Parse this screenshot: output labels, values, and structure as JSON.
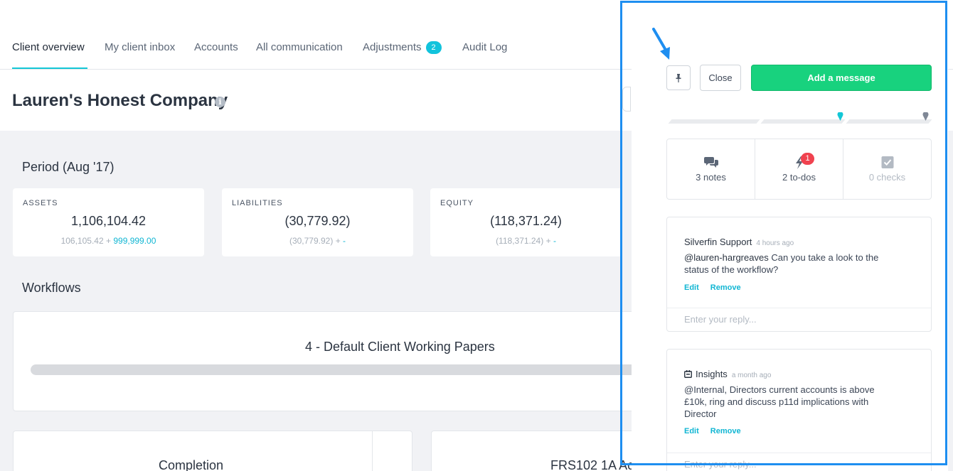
{
  "nav": {
    "tabs": [
      {
        "label": "Client overview",
        "active": true
      },
      {
        "label": "My client inbox"
      },
      {
        "label": "Accounts"
      },
      {
        "label": "All communication"
      },
      {
        "label": "Adjustments",
        "badge": "2"
      },
      {
        "label": "Audit Log"
      }
    ]
  },
  "company": {
    "name": "Lauren's Honest Company"
  },
  "period": {
    "title": "Period (Aug '17)"
  },
  "kpis": [
    {
      "label": "ASSETS",
      "value": "1,106,104.42",
      "base": "106,105.42",
      "sep": "+",
      "adjustment": "999,999.00"
    },
    {
      "label": "LIABILITIES",
      "value": "(30,779.92)",
      "base": "(30,779.92)",
      "sep": "+",
      "adjustment": "-"
    },
    {
      "label": "EQUITY",
      "value": "(118,371.24)",
      "base": "(118,371.24)",
      "sep": "+",
      "adjustment": "-"
    }
  ],
  "workflows": {
    "title": "Workflows",
    "items": [
      {
        "name": "4 - Default Client Working Papers"
      }
    ]
  },
  "bottom_cards": [
    {
      "title": "Completion"
    },
    {
      "title": "FRS102 1A Ac"
    }
  ],
  "panel": {
    "close_label": "Close",
    "add_label": "Add a message",
    "stats": [
      {
        "label": "3 notes",
        "icon": "notes-icon"
      },
      {
        "label": "2 to-dos",
        "icon": "todo-icon",
        "badge": "1"
      },
      {
        "label": "0 checks",
        "icon": "checks-icon"
      }
    ],
    "messages": [
      {
        "author": "Silverfin Support",
        "time": "4 hours ago",
        "mention": "@lauren-hargreaves",
        "text": "Can you take a look to the status of the workflow?",
        "edit": "Edit",
        "remove": "Remove",
        "reply_placeholder": "Enter your reply..."
      },
      {
        "author": "Insights",
        "time": "a month ago",
        "mention": "@Internal,",
        "text": "Directors current accounts is above £10k, ring and discuss p11d implications with Director",
        "edit": "Edit",
        "remove": "Remove",
        "reply_placeholder": "Enter your reply..."
      }
    ]
  },
  "colors": {
    "accent": "#13c7d6",
    "add_button": "#18d27e",
    "highlight_box": "#1e8ef0",
    "alert_badge": "#f0424f"
  }
}
